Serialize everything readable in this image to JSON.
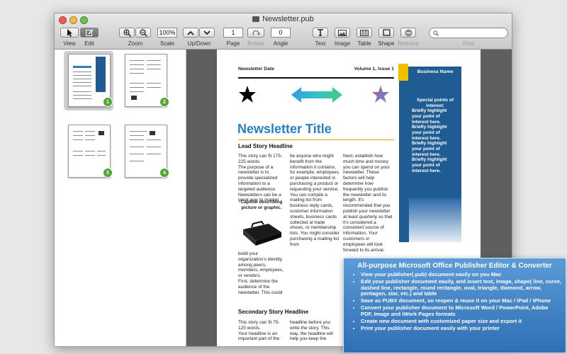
{
  "window": {
    "title": "Newsletter.pub"
  },
  "toolbar": {
    "view": "View",
    "edit": "Edit",
    "zoom": "Zoom",
    "zoom_value": "100%",
    "scale": "Scale",
    "updown": "Up/Down",
    "page_value": "1",
    "page": "Page",
    "rotate": "Rotate",
    "angle_value": "0",
    "angle": "Angle",
    "text": "Text",
    "image": "Image",
    "table": "Table",
    "shape": "Shape",
    "remove": "Remove",
    "find": "Find"
  },
  "thumbnails": [
    "1",
    "2",
    "3",
    "4"
  ],
  "newsletter": {
    "date": "Newsletter Date",
    "volume": "Volume 1, Issue 1",
    "title": "Newsletter Title",
    "lead_headline": "Lead Story Headline",
    "col1a": "This story can fit 175-225 words.\nThe purpose of a newsletter is to provide specialized information to a targeted audience. Newsletters can be a great way to market",
    "caption": "Caption describing picture or graphic.",
    "col1b": "build your organization's identity among peers, members, employees, or vendors.\nFirst, determine the audience of the newsletter. This could",
    "col2": "be anyone who might benefit from the information it contains, for example, employees or people interested in purchasing a product or requesting your service.\nYou can compile a mailing list from business reply cards, customer information sheets, business cards collected at trade shows, or membership lists. You might consider purchasing a mailing list from",
    "col3": "Next, establish how much time and money you can spend on your newsletter. These factors will help determine how frequently you publish the newsletter and its length. It's recommended that you publish your newsletter at least quarterly so that it's considered a consistent source of information. Your customers or employees will look forward to its arrival.",
    "secondary_headline": "Secondary Story Headline",
    "sec_col1": "This story can fit 75-125 words.\nYour headline is an important part of the",
    "sec_col2": "headline before you write the story. This way, the headline will help you keep the",
    "sidebar_business": "Business Name",
    "sidebar_points": "Special points of interest:",
    "sidebar_items": [
      "Briefly highlight your point of interest here.",
      "Briefly highlight your point of interest here.",
      "Briefly highlight your point of interest here.",
      "Briefly highlight your point of interest here."
    ]
  },
  "promo": {
    "title": "All-purpose Microsoft Office Publisher Editor & Converter",
    "items": [
      "View your publisher(.pub) document easily on you Mac",
      "Edit your publisher document easily, and insert text, image, shape( line, curve, dashed line, rectangle, round rectangle, oval, triangle, diamond, arrow, pentagon, star, etc.) and table",
      "Save as PUBX document, so reopen & reuse it on your Mac / iPad / iPhone",
      "Convert your publisher document to Microsoft Word / PowerPoint, Adobe PDF, Image and iWork Pages formats",
      "Create new document with customized paper size and export it",
      "Print your publisher document easily with your printer"
    ]
  },
  "colors": {
    "accent": "#2a7fc4",
    "sidebar": "#1f5c93",
    "badge": "#51a634",
    "promo": "#3f82c6"
  }
}
